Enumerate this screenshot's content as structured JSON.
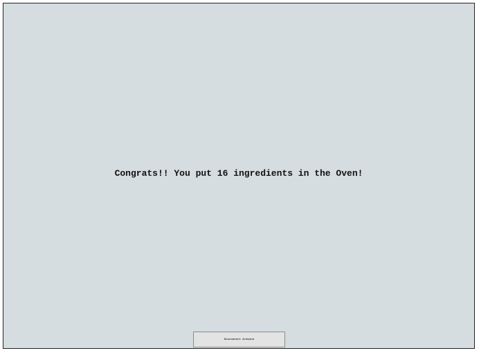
{
  "main": {
    "message": "Congrats!! You put 16 ingredients in the Oven!"
  },
  "footer": {
    "button_label": "Disconnect Arduino"
  }
}
